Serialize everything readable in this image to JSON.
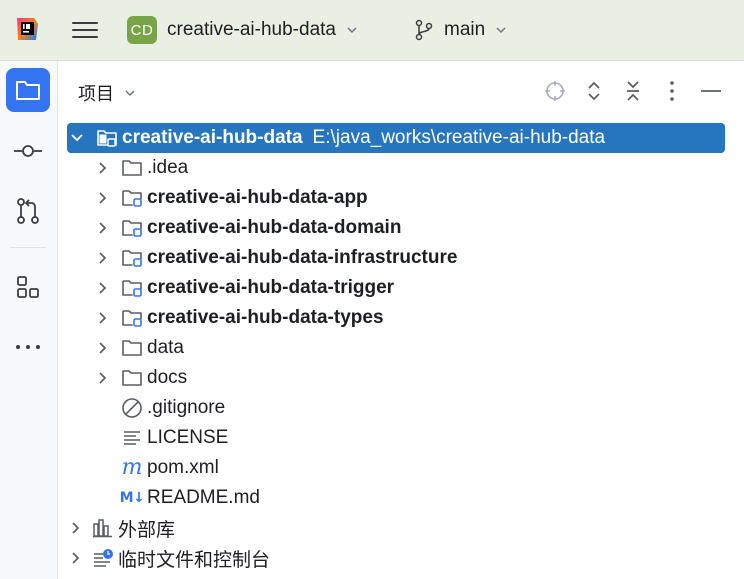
{
  "titlebar": {
    "project_badge": "CD",
    "project_name": "creative-ai-hub-data",
    "branch_name": "main"
  },
  "toolstrip": {
    "items": [
      "project",
      "commit",
      "pull-requests",
      "structure",
      "more"
    ]
  },
  "panel": {
    "title": "项目"
  },
  "tree": {
    "root": {
      "label": "creative-ai-hub-data",
      "path": "E:\\java_works\\creative-ai-hub-data"
    },
    "items": [
      {
        "label": ".idea",
        "kind": "folder"
      },
      {
        "label": "creative-ai-hub-data-app",
        "kind": "module"
      },
      {
        "label": "creative-ai-hub-data-domain",
        "kind": "module"
      },
      {
        "label": "creative-ai-hub-data-infrastructure",
        "kind": "module"
      },
      {
        "label": "creative-ai-hub-data-trigger",
        "kind": "module"
      },
      {
        "label": "creative-ai-hub-data-types",
        "kind": "module"
      },
      {
        "label": "data",
        "kind": "folder"
      },
      {
        "label": "docs",
        "kind": "folder"
      },
      {
        "label": ".gitignore",
        "kind": "ignore-file"
      },
      {
        "label": "LICENSE",
        "kind": "text-file"
      },
      {
        "label": "pom.xml",
        "kind": "maven-file"
      },
      {
        "label": "README.md",
        "kind": "markdown-file"
      }
    ],
    "external_libraries": "外部库",
    "scratches": "临时文件和控制台"
  },
  "colors": {
    "accent": "#3574f0",
    "selection": "#2675bf",
    "module_badge": "#3574f0",
    "project_badge": "#78a548"
  }
}
